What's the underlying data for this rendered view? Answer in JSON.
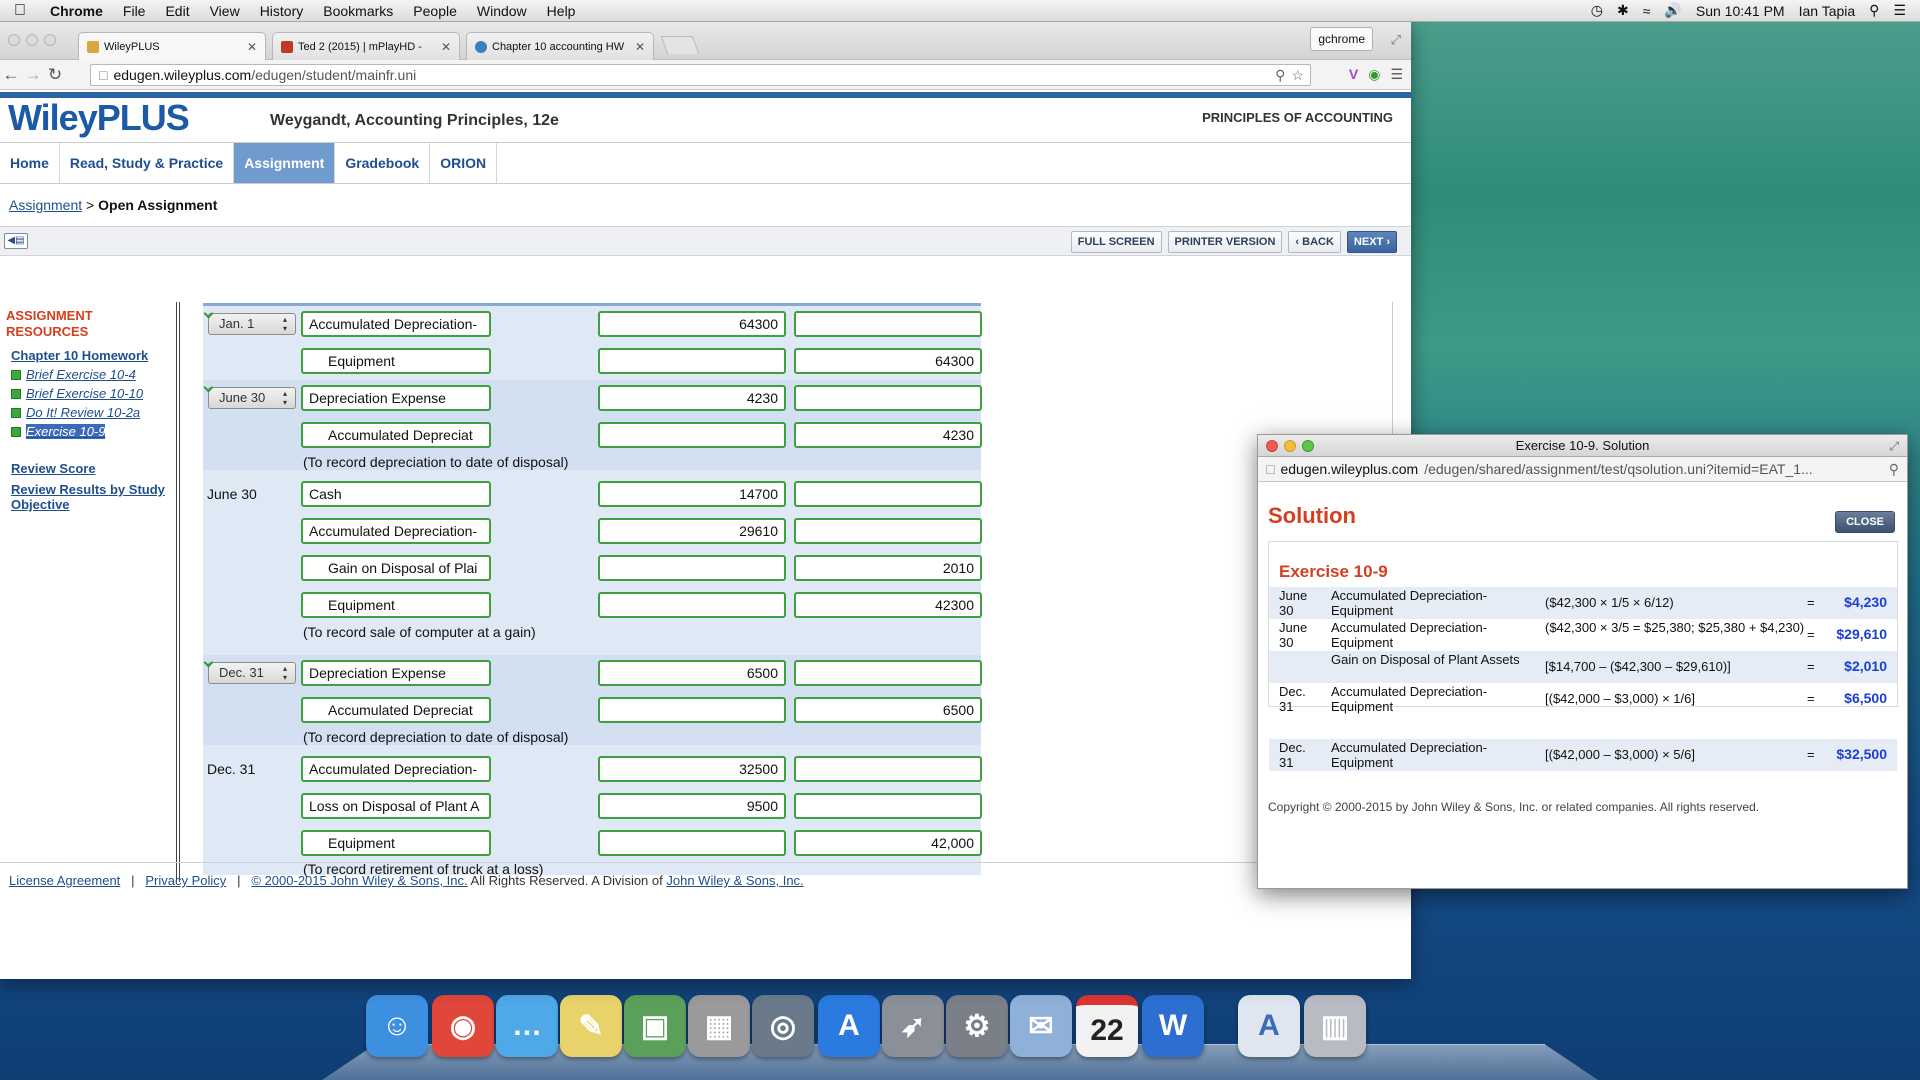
{
  "menubar": {
    "app": "Chrome",
    "items": [
      "File",
      "Edit",
      "View",
      "History",
      "Bookmarks",
      "People",
      "Window",
      "Help"
    ],
    "clock": "Sun 10:41 PM",
    "user": "Ian Tapia"
  },
  "browser": {
    "tabs": [
      {
        "label": "WileyPLUS",
        "icon": "wiley-favicon",
        "color": "#d9a640"
      },
      {
        "label": "Ted 2 (2015) | mPlayHD -",
        "icon": "movie-favicon",
        "color": "#c0392b"
      },
      {
        "label": "Chapter 10 accounting HW",
        "icon": "loading-favicon",
        "color": "#3b82c4"
      }
    ],
    "profile": "gchrome",
    "url_host": "edugen.wileyplus.com",
    "url_path": "/edugen/student/mainfr.uni"
  },
  "site": {
    "logo": "WileyPLUS",
    "book_title": "Weygandt, Accounting Principles, 12e",
    "course_title": "PRINCIPLES OF ACCOUNTING",
    "nav": [
      {
        "label": "Home",
        "active": false
      },
      {
        "label": "Read, Study & Practice",
        "active": false
      },
      {
        "label": "Assignment",
        "active": true
      },
      {
        "label": "Gradebook",
        "active": false
      },
      {
        "label": "ORION",
        "active": false
      }
    ],
    "breadcrumb_link": "Assignment",
    "breadcrumb_sep": ">",
    "breadcrumb_current": "Open Assignment",
    "actions": {
      "full_screen": "FULL SCREEN",
      "printer": "PRINTER VERSION",
      "back": "BACK",
      "next": "NEXT"
    }
  },
  "sidebar": {
    "title": "ASSIGNMENT RESOURCES",
    "chapter": "Chapter 10 Homework",
    "exercises": [
      "Brief Exercise 10-4",
      "Brief Exercise 10-10",
      "Do It! Review 10-2a",
      "Exercise 10-9"
    ],
    "current_index": 3,
    "review_score": "Review Score",
    "review_results": "Review Results by Study Objective"
  },
  "journal": {
    "dates": {
      "d1": "Jan. 1",
      "d2": "June 30",
      "d3": "June 30",
      "d4": "Dec. 31",
      "d5": "Dec. 31"
    },
    "rows": [
      {
        "account": "Accumulated Depreciation-",
        "debit": "64300",
        "credit": ""
      },
      {
        "account": "Equipment",
        "debit": "",
        "credit": "64300"
      },
      {
        "account": "Depreciation Expense",
        "debit": "4230",
        "credit": ""
      },
      {
        "account": "Accumulated Depreciat",
        "debit": "",
        "credit": "4230"
      },
      {
        "account": "Cash",
        "debit": "14700",
        "credit": ""
      },
      {
        "account": "Accumulated Depreciation-",
        "debit": "29610",
        "credit": ""
      },
      {
        "account": "Gain on Disposal of Plai",
        "debit": "",
        "credit": "2010"
      },
      {
        "account": "Equipment",
        "debit": "",
        "credit": "42300"
      },
      {
        "account": "Depreciation Expense",
        "debit": "6500",
        "credit": ""
      },
      {
        "account": "Accumulated Depreciat",
        "debit": "",
        "credit": "6500"
      },
      {
        "account": "Accumulated Depreciation-",
        "debit": "32500",
        "credit": ""
      },
      {
        "account": "Loss on Disposal of Plant A",
        "debit": "9500",
        "credit": ""
      },
      {
        "account": "Equipment",
        "debit": "",
        "credit": "42,000"
      }
    ],
    "memos": [
      "(To record depreciation to date of disposal)",
      "(To record sale of computer at a gain)",
      "(To record depreciation to date of disposal)",
      "(To record retirement of truck at a loss)"
    ]
  },
  "footer": {
    "license": "License Agreement",
    "sep": "|",
    "privacy": "Privacy Policy",
    "copyright_link": "© 2000-2015 John Wiley & Sons, Inc.",
    "rights": "All Rights Reserved. A Division of",
    "division_link": "John Wiley & Sons, Inc."
  },
  "popup": {
    "window_title": "Exercise 10-9. Solution",
    "url_host": "edugen.wileyplus.com",
    "url_path": "/edugen/shared/assignment/test/qsolution.uni?itemid=EAT_1...",
    "heading": "Solution",
    "close": "CLOSE",
    "exercise_title": "Exercise 10-9",
    "rows": [
      {
        "date": "June 30",
        "account": "Accumulated Depreciation-Equipment",
        "formula": "($42,300 × 1/5 × 6/12)",
        "eq": "=",
        "value": "$4,230"
      },
      {
        "date": "June 30",
        "account": "Accumulated Depreciation-Equipment",
        "formula": "($42,300 × 3/5 = $25,380; $25,380 + $4,230)",
        "eq": "=",
        "value": "$29,610"
      },
      {
        "date": "",
        "account": "Gain on Disposal of Plant Assets",
        "formula": "[$14,700 – ($42,300 – $29,610)]",
        "eq": "=",
        "value": "$2,010"
      },
      {
        "date": "Dec. 31",
        "account": "Accumulated Depreciation-Equipment",
        "formula": "[($42,000 – $3,000) × 1/6]",
        "eq": "=",
        "value": "$6,500"
      },
      {
        "date": "Dec. 31",
        "account": "Accumulated Depreciation-Equipment",
        "formula": "[($42,000 – $3,000) × 5/6]",
        "eq": "=",
        "value": "$32,500"
      }
    ],
    "copyright": "Copyright © 2000-2015 by John Wiley & Sons, Inc. or related companies. All rights reserved."
  },
  "dock": {
    "apps": [
      {
        "name": "finder-icon",
        "glyph": "☺",
        "color": "#3d8fe0"
      },
      {
        "name": "chrome-icon",
        "glyph": "◉",
        "color": "#e0463a"
      },
      {
        "name": "messages-icon",
        "glyph": "…",
        "color": "#4fa8e8"
      },
      {
        "name": "notes-icon",
        "glyph": "✎",
        "color": "#e8d36a"
      },
      {
        "name": "iphoto-icon",
        "glyph": "▣",
        "color": "#5aa05a"
      },
      {
        "name": "calculator-icon",
        "glyph": "▦",
        "color": "#9a9a9a"
      },
      {
        "name": "facetime-icon",
        "glyph": "◎",
        "color": "#6a7a8a"
      },
      {
        "name": "app-store-icon",
        "glyph": "A",
        "color": "#2a7ae0"
      },
      {
        "name": "launchpad-icon",
        "glyph": "➶",
        "color": "#8a8f98"
      },
      {
        "name": "system-preferences-icon",
        "glyph": "⚙",
        "color": "#7a7f88"
      },
      {
        "name": "mail-icon",
        "glyph": "✉",
        "color": "#8fb0d8"
      },
      {
        "name": "calendar-icon",
        "glyph": "22",
        "color": "#f2f2f2"
      },
      {
        "name": "word-icon",
        "glyph": "W",
        "color": "#2c6fd0"
      },
      {
        "name": "docx-file-icon",
        "glyph": "A",
        "color": "#dfe6ef"
      },
      {
        "name": "trash-icon",
        "glyph": "▥",
        "color": "#b8bcc2"
      }
    ]
  }
}
